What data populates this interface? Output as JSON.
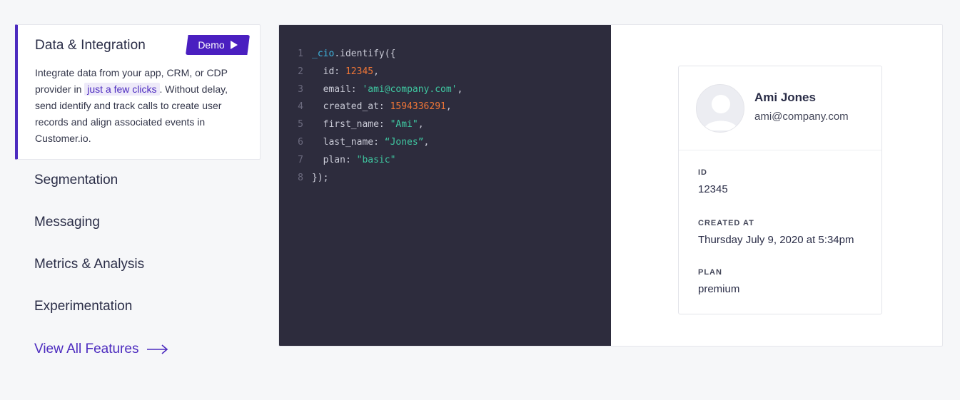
{
  "sidebar": {
    "active": {
      "title": "Data & Integration",
      "demo_label": "Demo",
      "desc_before": "Integrate data from your app, CRM, or CDP provider in ",
      "desc_highlight": "just a few clicks",
      "desc_after": ". Without delay, send identify and track calls to create user records and align associated events in Customer.io."
    },
    "items": [
      "Segmentation",
      "Messaging",
      "Metrics & Analysis",
      "Experimentation"
    ],
    "view_all": "View All Features"
  },
  "code": {
    "lines": [
      {
        "n": "1",
        "obj": "_cio",
        "rest": ".identify({"
      },
      {
        "n": "2",
        "key": "  id: ",
        "num": "12345",
        "tail": ","
      },
      {
        "n": "3",
        "key": "  email: ",
        "str": "'ami@company.com'",
        "tail": ","
      },
      {
        "n": "4",
        "key": "  created_at: ",
        "num": "1594336291",
        "tail": ","
      },
      {
        "n": "5",
        "key": "  first_name: ",
        "str": "\"Ami\"",
        "tail": ","
      },
      {
        "n": "6",
        "key": "  last_name: ",
        "str": "“Jones”",
        "tail": ","
      },
      {
        "n": "7",
        "key": "  plan: ",
        "str": "\"basic\"",
        "tail": ""
      },
      {
        "n": "8",
        "key": "});",
        "tail": ""
      }
    ]
  },
  "profile": {
    "name": "Ami Jones",
    "email": "ami@company.com",
    "fields": [
      {
        "label": "ID",
        "value": "12345"
      },
      {
        "label": "CREATED AT",
        "value": "Thursday July 9, 2020 at 5:34pm"
      },
      {
        "label": "PLAN",
        "value": "premium"
      }
    ]
  },
  "colors": {
    "accent": "#4c2bbf",
    "code_bg": "#2d2c3d",
    "code_number": "#f07637",
    "code_string": "#3fc6a0",
    "code_object": "#3fb6e0"
  },
  "icons": {
    "demo": "play-icon",
    "view_all": "arrow-right-icon",
    "avatar": "user-avatar-icon"
  }
}
